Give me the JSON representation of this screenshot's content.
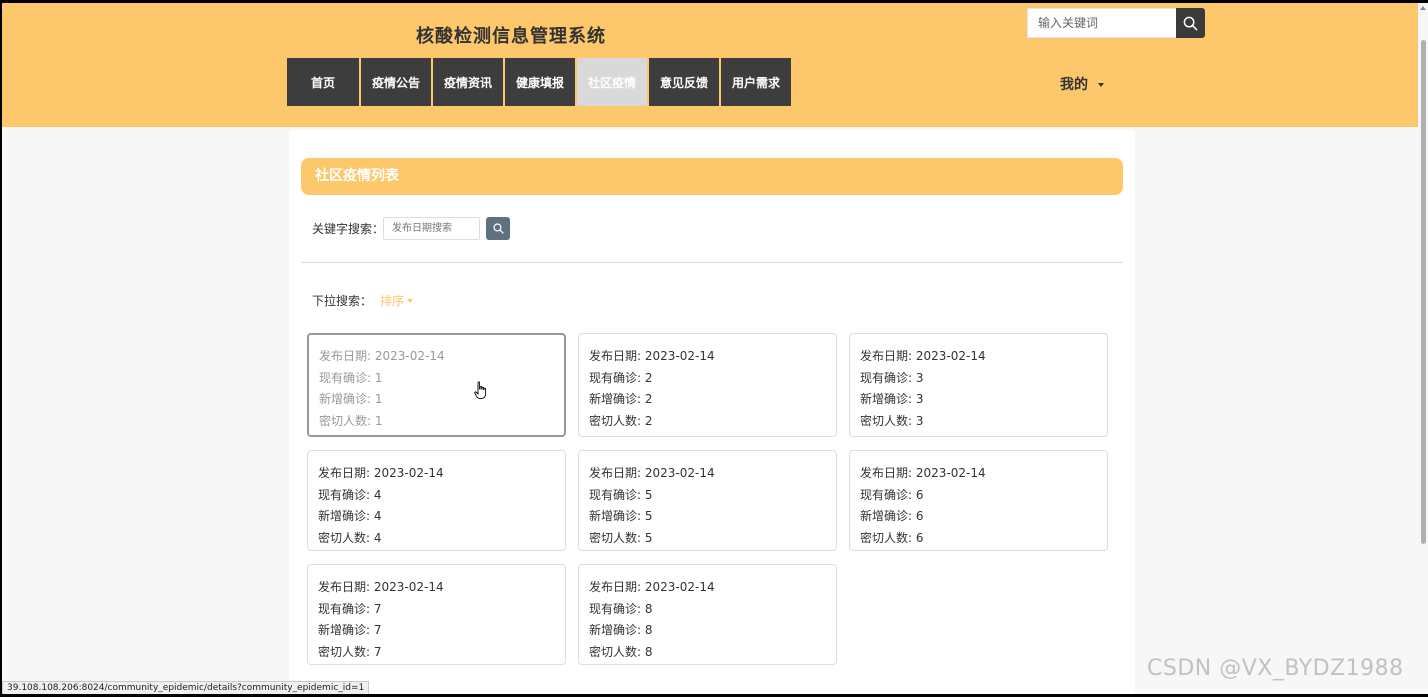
{
  "header": {
    "title": "核酸检测信息管理系统",
    "search_placeholder": "输入关键词",
    "user_menu": "我的"
  },
  "nav": [
    {
      "label": "首页",
      "active": false
    },
    {
      "label": "疫情公告",
      "active": false
    },
    {
      "label": "疫情资讯",
      "active": false
    },
    {
      "label": "健康填报",
      "active": false
    },
    {
      "label": "社区疫情",
      "active": true
    },
    {
      "label": "意见反馈",
      "active": false
    },
    {
      "label": "用户需求",
      "active": false
    }
  ],
  "section": {
    "title": "社区疫情列表",
    "keyword_label": "关键字搜索：",
    "keyword_placeholder": "发布日期搜索",
    "dropdown_label": "下拉搜索：",
    "sort_label": "排序"
  },
  "cards": [
    {
      "date": "发布日期: 2023-02-14",
      "current": "现有确诊: 1",
      "new": "新增确诊: 1",
      "contacts": "密切人数: 1"
    },
    {
      "date": "发布日期: 2023-02-14",
      "current": "现有确诊: 2",
      "new": "新增确诊: 2",
      "contacts": "密切人数: 2"
    },
    {
      "date": "发布日期: 2023-02-14",
      "current": "现有确诊: 3",
      "new": "新增确诊: 3",
      "contacts": "密切人数: 3"
    },
    {
      "date": "发布日期: 2023-02-14",
      "current": "现有确诊: 4",
      "new": "新增确诊: 4",
      "contacts": "密切人数: 4"
    },
    {
      "date": "发布日期: 2023-02-14",
      "current": "现有确诊: 5",
      "new": "新增确诊: 5",
      "contacts": "密切人数: 5"
    },
    {
      "date": "发布日期: 2023-02-14",
      "current": "现有确诊: 6",
      "new": "新增确诊: 6",
      "contacts": "密切人数: 6"
    },
    {
      "date": "发布日期: 2023-02-14",
      "current": "现有确诊: 7",
      "new": "新增确诊: 7",
      "contacts": "密切人数: 7"
    },
    {
      "date": "发布日期: 2023-02-14",
      "current": "现有确诊: 8",
      "new": "新增确诊: 8",
      "contacts": "密切人数: 8"
    }
  ],
  "status_bar": "39.108.108.206:8024/community_epidemic/details?community_epidemic_id=1",
  "watermark": "CSDN @VX_BYDZ1988",
  "colors": {
    "accent": "#fdc76b",
    "nav_bg": "#3d3d3d",
    "nav_active_bg": "#d9d9d9",
    "search_btn": "#3a3a3a",
    "kw_btn": "#607080"
  },
  "icons": [
    "search-icon",
    "chevron-down-icon",
    "hand-cursor-icon"
  ]
}
